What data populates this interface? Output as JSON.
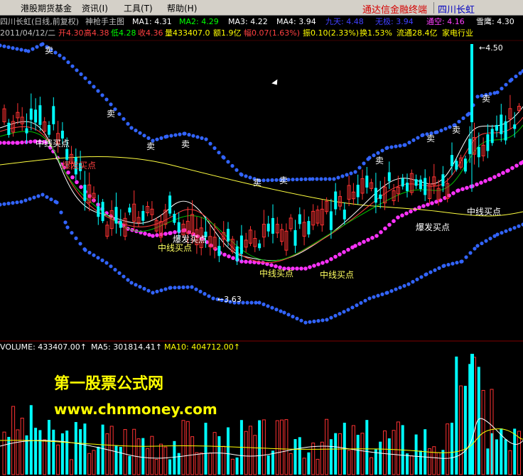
{
  "menu": {
    "items": [
      "港股期货基金",
      "资讯(I)",
      "工具(T)",
      "帮助(H)"
    ],
    "brand": "通达信金融终端",
    "stock": "四川长虹"
  },
  "info": {
    "line1": [
      {
        "text": "四川长虹(日线,前复权)",
        "color": "#c0c0c0"
      },
      {
        "text": "神枪手主图",
        "color": "#c0c0c0"
      },
      {
        "text": "MA1: 4.31",
        "color": "#ffffff"
      },
      {
        "text": "MA2: 4.29",
        "color": "#00ff00"
      },
      {
        "text": "MA3: 4.22",
        "color": "#ffffff"
      },
      {
        "text": "MA4: 3.94",
        "color": "#ffffff"
      },
      {
        "text": "九天: 4.48",
        "color": "#4040ff"
      },
      {
        "text": "无极: 3.94",
        "color": "#4040ff"
      },
      {
        "text": "通空: 4.16",
        "color": "#ff40ff"
      },
      {
        "text": "雪鹰: 4.30",
        "color": "#ffffff"
      }
    ],
    "line2": [
      {
        "text": "2011/04/12/二",
        "color": "#c0c0c0"
      },
      {
        "text": "开4.30",
        "color": "#ff4040"
      },
      {
        "text": "高4.38",
        "color": "#ff4040"
      },
      {
        "text": "低4.28",
        "color": "#00ff00"
      },
      {
        "text": "收4.36",
        "color": "#ff4040"
      },
      {
        "text": "量433407.0",
        "color": "#ffff00"
      },
      {
        "text": "额1.9亿",
        "color": "#ffff00"
      },
      {
        "text": "幅0.07(1.63%)",
        "color": "#ff4040"
      },
      {
        "text": "振0.10(2.33%)",
        "color": "#ffff00"
      },
      {
        "text": "换1.53%",
        "color": "#ffff00"
      },
      {
        "text": "流通28.4亿",
        "color": "#ffff00"
      },
      {
        "text": "家电行业",
        "color": "#ffff00"
      }
    ]
  },
  "volume_info": [
    {
      "text": "VOLUME: 433407.00↑",
      "color": "#ffffff"
    },
    {
      "text": "MA5: 301814.41↑",
      "color": "#ffffff"
    },
    {
      "text": "MA10: 404712.00↑",
      "color": "#ffff00"
    }
  ],
  "chart_data": {
    "type": "candlestick",
    "price_labels": {
      "high": "4.50",
      "low": "3.63"
    },
    "signals": [
      "卖",
      "卖",
      "卖",
      "卖",
      "卖",
      "卖",
      "卖",
      "卖",
      "卖"
    ],
    "buy_labels": [
      "中线买点",
      "爆发买点",
      "爆发买点",
      "中线买点",
      "中线买点",
      "中线买点",
      "爆发买点",
      "中线买点"
    ]
  },
  "watermark": {
    "line1": "第一股票公式网",
    "line2": "www.chnmoney.com"
  },
  "colors": {
    "up": "#ff3232",
    "down": "#00ffff",
    "upper_band": "#3264ff",
    "lower_dots": "#ff32ff",
    "ma_long": "#ffff40"
  }
}
